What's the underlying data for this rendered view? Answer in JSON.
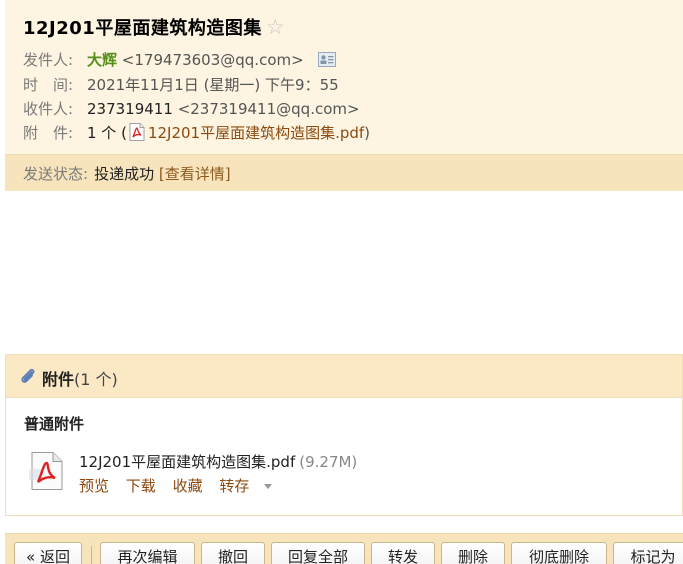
{
  "email": {
    "subject": "12J201平屋面建筑构造图集",
    "star_icon": "star-outline-icon",
    "sender_label": "发件人:",
    "sender_name": "大辉",
    "sender_email": "<179473603@qq.com>",
    "time_label": "时　间:",
    "time": "2021年11月1日 (星期一) 下午9：55",
    "recipient_label": "收件人:",
    "recipient_name": "237319411",
    "recipient_email": "<237319411@qq.com>",
    "attachment_label": "附　件:",
    "attachment_count": "1 个 (",
    "attachment_name": "12J201平屋面建筑构造图集.pdf",
    "attachment_close": ")",
    "status_label": "发送状态:",
    "status_value": "投递成功",
    "status_link": "[查看详情]"
  },
  "attachments": {
    "title": "附件",
    "count": "(1 个)",
    "section_title": "普通附件",
    "file_name": "12J201平屋面建筑构造图集.pdf",
    "file_size": "(9.27M)",
    "actions": {
      "preview": "预览",
      "download": "下载",
      "favorite": "收藏",
      "forward": "转存"
    }
  },
  "toolbar": {
    "back": "« 返回",
    "reedit": "再次编辑",
    "recall": "撤回",
    "reply_all": "回复全部",
    "forward": "转发",
    "delete": "删除",
    "delete_permanent": "彻底删除",
    "mark_as": "标记为"
  },
  "colors": {
    "header_bg": "#fdf4e1",
    "status_bg": "#f7e4bc",
    "link": "#8c4a10",
    "sender_green": "#55901a"
  }
}
